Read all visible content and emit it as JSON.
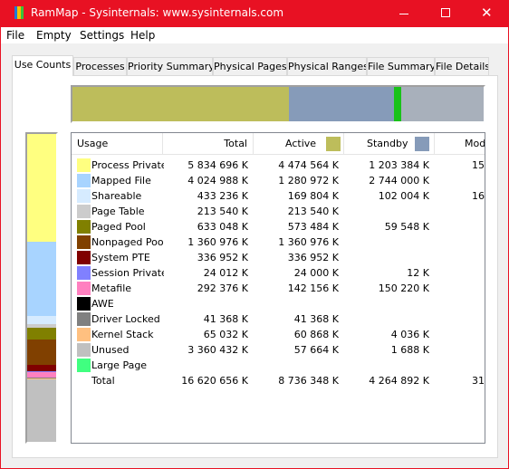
{
  "window": {
    "title": "RamMap - Sysinternals: www.sysinternals.com",
    "icon_colors": [
      "#e81123",
      "#1e7bd8",
      "#f6c000",
      "#3ac23a"
    ],
    "controls": {
      "minimize_icon": "minimize-icon",
      "maximize_icon": "maximize-icon",
      "close_icon": "close-icon",
      "close_glyph": "✕"
    }
  },
  "menu": [
    "File",
    "Empty",
    "Settings",
    "Help"
  ],
  "tabs": [
    "Use Counts",
    "Processes",
    "Priority Summary",
    "Physical Pages",
    "Physical Ranges",
    "File Summary",
    "File Details"
  ],
  "active_tab": "Use Counts",
  "summary_bar": [
    {
      "name": "active",
      "color": "#bdbd5b",
      "value_k": 8736348
    },
    {
      "name": "standby",
      "color": "#869bb9",
      "value_k": 4264892
    },
    {
      "name": "modified",
      "color": "#19c219",
      "value_k": 310000
    },
    {
      "name": "other",
      "color": "#a8b0bb",
      "value_k": 3309416
    }
  ],
  "columns": {
    "usage": "Usage",
    "total": "Total",
    "active": "Active",
    "standby": "Standby",
    "modified": "Modifie"
  },
  "legend_colors": {
    "active": "#bdbd5b",
    "standby": "#869bb9"
  },
  "rows": [
    {
      "name": "Process Private",
      "color": "#ffff80",
      "total": "5 834 696 K",
      "active": "4 474 564 K",
      "standby": "1 203 384 K",
      "modified": "15"
    },
    {
      "name": "Mapped File",
      "color": "#a8d4ff",
      "total": "4 024 988 K",
      "active": "1 280 972 K",
      "standby": "2 744 000 K",
      "modified": ""
    },
    {
      "name": "Shareable",
      "color": "#d6ebff",
      "total": "433 236 K",
      "active": "169 804 K",
      "standby": "102 004 K",
      "modified": "16"
    },
    {
      "name": "Page Table",
      "color": "#cccccc",
      "total": "213 540 K",
      "active": "213 540 K",
      "standby": "",
      "modified": ""
    },
    {
      "name": "Paged Pool",
      "color": "#808000",
      "total": "633 048 K",
      "active": "573 484 K",
      "standby": "59 548 K",
      "modified": ""
    },
    {
      "name": "Nonpaged Pool",
      "color": "#804000",
      "total": "1 360 976 K",
      "active": "1 360 976 K",
      "standby": "",
      "modified": ""
    },
    {
      "name": "System PTE",
      "color": "#800000",
      "total": "336 952 K",
      "active": "336 952 K",
      "standby": "",
      "modified": ""
    },
    {
      "name": "Session Private",
      "color": "#8080ff",
      "total": "24 012 K",
      "active": "24 000 K",
      "standby": "12 K",
      "modified": ""
    },
    {
      "name": "Metafile",
      "color": "#ff80c0",
      "total": "292 376 K",
      "active": "142 156 K",
      "standby": "150 220 K",
      "modified": ""
    },
    {
      "name": "AWE",
      "color": "#000000",
      "total": "",
      "active": "",
      "standby": "",
      "modified": ""
    },
    {
      "name": "Driver Locked",
      "color": "#808080",
      "total": "41 368 K",
      "active": "41 368 K",
      "standby": "",
      "modified": ""
    },
    {
      "name": "Kernel Stack",
      "color": "#ffc080",
      "total": "65 032 K",
      "active": "60 868 K",
      "standby": "4 036 K",
      "modified": ""
    },
    {
      "name": "Unused",
      "color": "#c0c0c0",
      "total": "3 360 432 K",
      "active": "57 664 K",
      "standby": "1 688 K",
      "modified": ""
    },
    {
      "name": "Large Page",
      "color": "#40ff80",
      "total": "",
      "active": "",
      "standby": "",
      "modified": ""
    },
    {
      "name": "Total",
      "color": "",
      "total": "16 620 656 K",
      "active": "8 736 348 K",
      "standby": "4 264 892 K",
      "modified": "31"
    }
  ]
}
